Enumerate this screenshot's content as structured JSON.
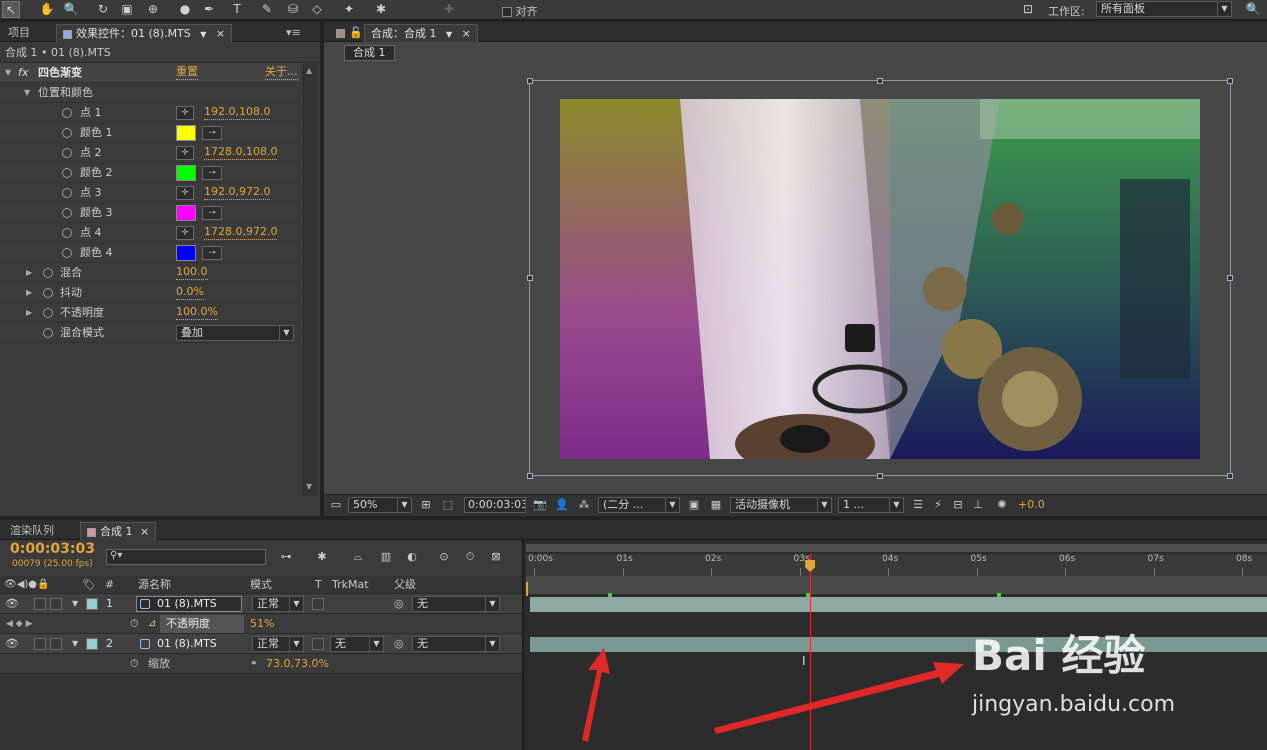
{
  "toolbar": {
    "snap_label": "对齐",
    "workspace_label": "工作区:",
    "workspace_value": "所有面板"
  },
  "left_panel": {
    "tab_project": "项目",
    "tab_effects": "效果控件：01 (8).MTS",
    "breadcrumb": "合成 1 • 01 (8).MTS",
    "effect": {
      "fx_label": "fx",
      "name": "四色渐变",
      "reset": "重置",
      "about": "关于...",
      "group_position_color": "位置和颜色",
      "properties": [
        {
          "name": "点 1",
          "value": "192.0,108.0"
        },
        {
          "name": "颜色 1",
          "color": "#ffff00"
        },
        {
          "name": "点 2",
          "value": "1728.0,108.0"
        },
        {
          "name": "颜色 2",
          "color": "#00ff00"
        },
        {
          "name": "点 3",
          "value": "192.0,972.0"
        },
        {
          "name": "颜色 3",
          "color": "#ff00ff"
        },
        {
          "name": "点 4",
          "value": "1728.0,972.0"
        },
        {
          "name": "颜色 4",
          "color": "#0000ff"
        }
      ],
      "blend_label": "混合",
      "blend_value": "100.0",
      "jitter_label": "抖动",
      "jitter_value": "0.0%",
      "opacity_label": "不透明度",
      "opacity_value": "100.0%",
      "blend_mode_label": "混合模式",
      "blend_mode_value": "叠加"
    }
  },
  "comp_panel": {
    "tab_label": "合成：合成 1",
    "comp_chip": "合成 1",
    "zoom": "50%",
    "timecode": "0:00:03:03",
    "resolution": "(二分 ...",
    "camera": "活动摄像机",
    "views": "1 ...",
    "exposure": "+0.0"
  },
  "timeline": {
    "tab_render": "渲染队列",
    "tab_comp": "合成 1",
    "timecode": "0:00:03:03",
    "frame_info": "00079 (25.00 fps)",
    "search_placeholder": "",
    "columns": {
      "num": "#",
      "source": "源名称",
      "mode": "模式",
      "t": "T",
      "trkmat": "TrkMat",
      "parent": "父级"
    },
    "layers": [
      {
        "num": "1",
        "name": "01 (8).MTS",
        "mode": "正常",
        "trkmat": "",
        "parent": "无"
      },
      {
        "num": "2",
        "name": "01 (8).MTS",
        "mode": "正常",
        "trkmat": "无",
        "parent": "无"
      }
    ],
    "layer1_prop": {
      "name": "不透明度",
      "value": "51%"
    },
    "layer2_prop": {
      "name": "缩放",
      "value": "73.0,73.0%"
    },
    "ruler": [
      "0:00s",
      "01s",
      "02s",
      "03s",
      "04s",
      "05s",
      "06s",
      "07s",
      "08s"
    ],
    "playhead_seconds": 3.12
  },
  "watermark": {
    "logo": "Bai 经验",
    "url": "jingyan.baidu.com"
  }
}
